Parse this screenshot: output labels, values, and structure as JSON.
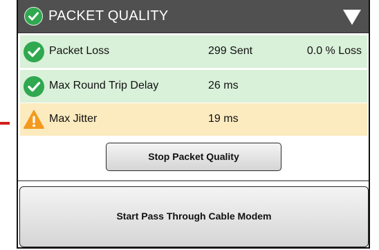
{
  "header": {
    "title": "PACKET QUALITY"
  },
  "rows": [
    {
      "status": "ok",
      "label": "Packet Loss",
      "value": "299 Sent",
      "extra": "0.0 % Loss"
    },
    {
      "status": "ok",
      "label": "Max Round Trip Delay",
      "value": "26 ms",
      "extra": ""
    },
    {
      "status": "warning",
      "label": "Max Jitter",
      "value": "19 ms",
      "extra": ""
    }
  ],
  "buttons": {
    "stop_label": "Stop Packet Quality",
    "start_label": "Start Pass Through Cable Modem"
  },
  "colors": {
    "header_bg": "#505050",
    "ok_row": "#d9f0d9",
    "warn_row": "#fcebbf",
    "check_green": "#2fa84f",
    "warning_orange": "#f39a1e",
    "marker_red": "#d2201a"
  }
}
